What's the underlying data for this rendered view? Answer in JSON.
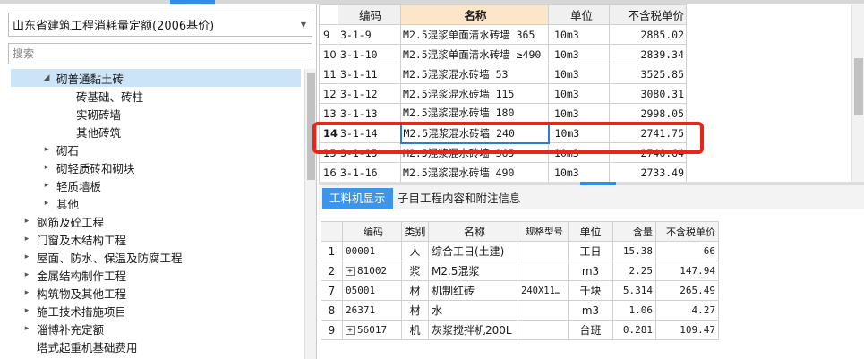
{
  "library": {
    "selected": "山东省建筑工程消耗量定额(2006基价)",
    "search_placeholder": "搜索"
  },
  "tree": [
    {
      "label": "砌普通黏土砖",
      "toggle": "◢",
      "indent": 3,
      "selected": true
    },
    {
      "label": "砖基础、砖柱",
      "toggle": "",
      "indent": 5,
      "selected": false
    },
    {
      "label": "实砌砖墙",
      "toggle": "",
      "indent": 5,
      "selected": false
    },
    {
      "label": "其他砖筑",
      "toggle": "",
      "indent": 5,
      "selected": false
    },
    {
      "label": "砌石",
      "toggle": "▸",
      "indent": 3,
      "selected": false
    },
    {
      "label": "砌轻质砖和砌块",
      "toggle": "▸",
      "indent": 3,
      "selected": false
    },
    {
      "label": "轻质墙板",
      "toggle": "▸",
      "indent": 3,
      "selected": false
    },
    {
      "label": "其他",
      "toggle": "▸",
      "indent": 3,
      "selected": false
    },
    {
      "label": "钢筋及砼工程",
      "toggle": "▸",
      "indent": 1,
      "selected": false
    },
    {
      "label": "门窗及木结构工程",
      "toggle": "▸",
      "indent": 1,
      "selected": false
    },
    {
      "label": "屋面、防水、保温及防腐工程",
      "toggle": "▸",
      "indent": 1,
      "selected": false
    },
    {
      "label": "金属结构制作工程",
      "toggle": "▸",
      "indent": 1,
      "selected": false
    },
    {
      "label": "构筑物及其他工程",
      "toggle": "▸",
      "indent": 1,
      "selected": false
    },
    {
      "label": "施工技术措施项目",
      "toggle": "▸",
      "indent": 1,
      "selected": false
    },
    {
      "label": "淄博补充定额",
      "toggle": "▸",
      "indent": 1,
      "selected": false
    },
    {
      "label": "塔式起重机基础费用",
      "toggle": "",
      "indent": 1,
      "selected": false
    }
  ],
  "quota_grid": {
    "headers": [
      "编码",
      "名称",
      "单位",
      "不含税单价"
    ],
    "rows": [
      {
        "idx": "9",
        "code": "3-1-9",
        "name": "M2.5混浆单面清水砖墙 365",
        "unit": "10m3",
        "price": "2885.02"
      },
      {
        "idx": "10",
        "code": "3-1-10",
        "name": "M2.5混浆单面清水砖墙 ≥490",
        "unit": "10m3",
        "price": "2839.34"
      },
      {
        "idx": "11",
        "code": "3-1-11",
        "name": "M2.5混浆混水砖墙 53",
        "unit": "10m3",
        "price": "3525.85"
      },
      {
        "idx": "12",
        "code": "3-1-12",
        "name": "M2.5混浆混水砖墙 115",
        "unit": "10m3",
        "price": "3080.31"
      },
      {
        "idx": "13",
        "code": "3-1-13",
        "name": "M2.5混浆混水砖墙 180",
        "unit": "10m3",
        "price": "2998.05"
      },
      {
        "idx": "14",
        "code": "3-1-14",
        "name": "M2.5混浆混水砖墙 240",
        "unit": "10m3",
        "price": "2741.75"
      },
      {
        "idx": "15",
        "code": "3-1-15",
        "name": "M2.5混浆混水砖墙 365",
        "unit": "10m3",
        "price": "2746.64"
      },
      {
        "idx": "16",
        "code": "3-1-16",
        "name": "M2.5混浆混水砖墙 490",
        "unit": "10m3",
        "price": "2733.49"
      }
    ],
    "selected_index": 5
  },
  "tabs": {
    "tab1": "工料机显示",
    "tab2": "子目工程内容和附注信息"
  },
  "resource_grid": {
    "headers": [
      "",
      "编码",
      "类别",
      "名称",
      "规格型号",
      "单位",
      "含量",
      "不含税单价"
    ],
    "rows": [
      {
        "idx": "1",
        "expand": false,
        "code": "00001",
        "type": "人",
        "name": "综合工日(土建)",
        "spec": "",
        "unit": "工日",
        "qty": "15.38",
        "price": "66"
      },
      {
        "idx": "2",
        "expand": true,
        "code": "81002",
        "type": "浆",
        "name": "M2.5混浆",
        "spec": "",
        "unit": "m3",
        "qty": "2.25",
        "price": "147.94"
      },
      {
        "idx": "7",
        "expand": false,
        "code": "05001",
        "type": "材",
        "name": "机制红砖",
        "spec": "240X11…",
        "unit": "千块",
        "qty": "5.314",
        "price": "265.49"
      },
      {
        "idx": "8",
        "expand": false,
        "code": "26371",
        "type": "材",
        "name": "水",
        "spec": "",
        "unit": "m3",
        "qty": "1.06",
        "price": "4.27"
      },
      {
        "idx": "9",
        "expand": true,
        "code": "56017",
        "type": "机",
        "name": "灰浆搅拌机200L",
        "spec": "",
        "unit": "台班",
        "qty": "0.281",
        "price": "109.47"
      }
    ]
  },
  "colors": {
    "accent": "#3d95ea",
    "highlight_frame": "#e8241b",
    "selected_tree": "#cce4f7",
    "name_header": "#fbe6c9"
  }
}
